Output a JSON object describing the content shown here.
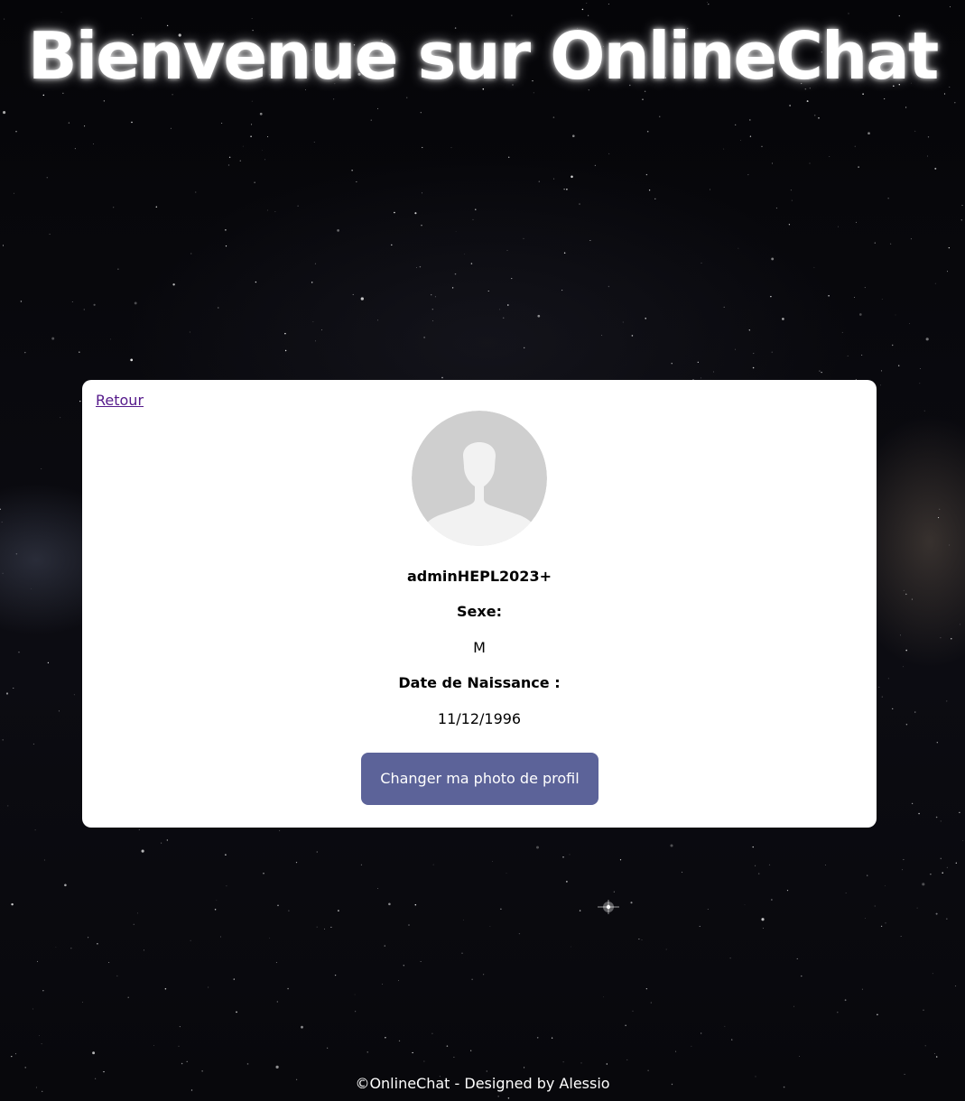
{
  "header": {
    "title": "Bienvenue sur OnlineChat"
  },
  "profile": {
    "back_label": "Retour",
    "avatar_icon": "default-user-avatar-icon",
    "username": "adminHEPL2023+",
    "sexe_label": "Sexe:",
    "sexe_value": "M",
    "dob_label": "Date de Naissance :",
    "dob_value": "11/12/1996",
    "change_photo_label": "Changer ma photo de profil"
  },
  "footer": {
    "text": "©OnlineChat - Designed by Alessio"
  },
  "colors": {
    "button_bg": "#5c6399",
    "link": "#551a8b",
    "card_bg": "#ffffff",
    "background": "#07070b"
  }
}
